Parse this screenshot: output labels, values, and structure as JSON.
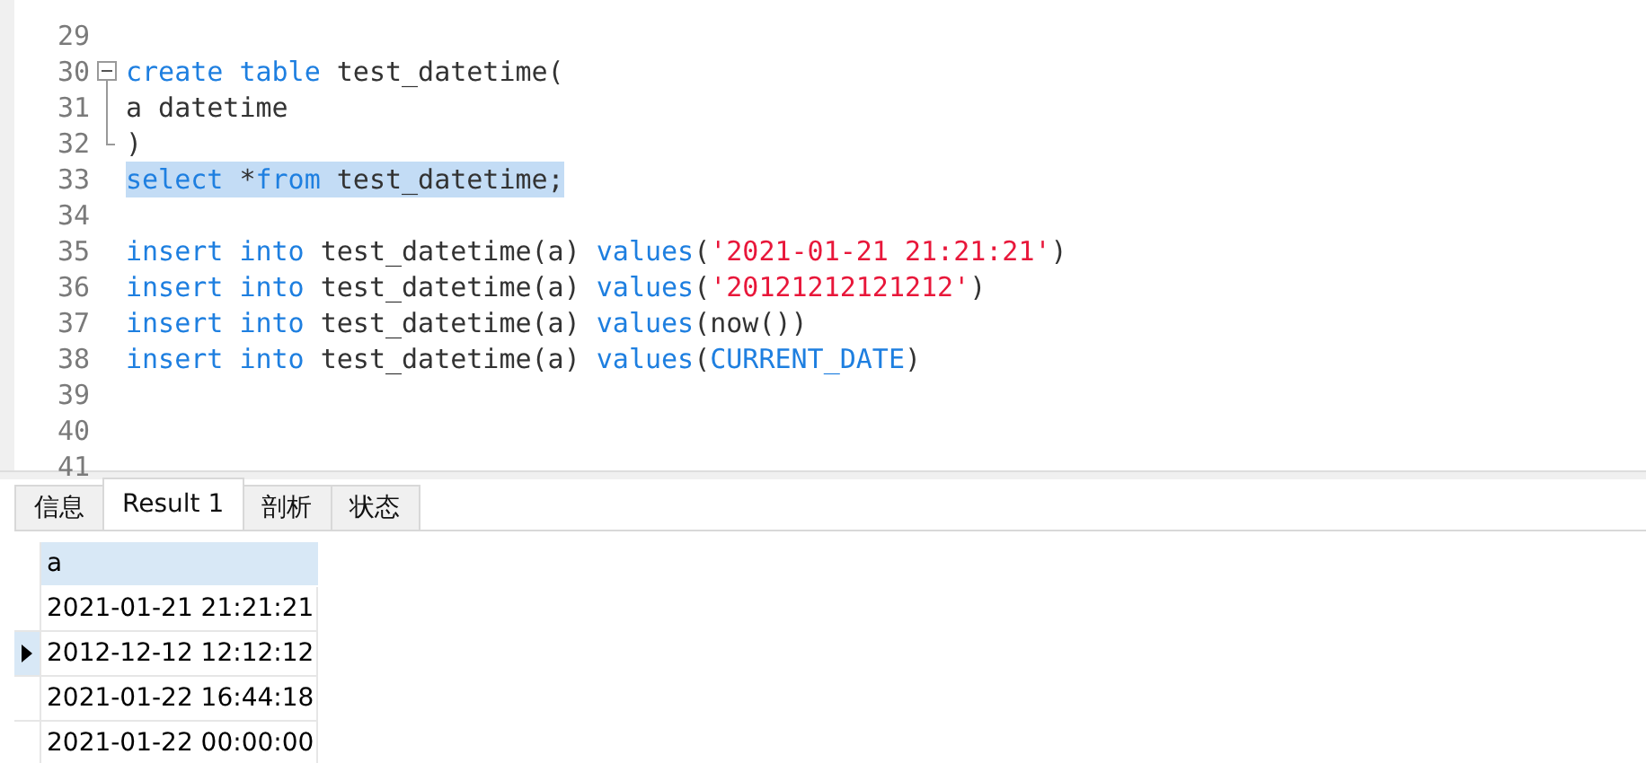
{
  "editor": {
    "lines": [
      {
        "number": "29",
        "kind": "plain",
        "selected": false
      },
      {
        "number": "30",
        "kind": "fold_start",
        "selected": false,
        "tokens": [
          {
            "kind": "keyword",
            "text": "create"
          },
          {
            "kind": "keyword",
            "text": " table"
          },
          {
            "kind": "plain",
            "text": " test_datetime("
          }
        ]
      },
      {
        "number": "31",
        "kind": "fold_line",
        "selected": false,
        "tokens": [
          {
            "kind": "plain",
            "text": "a datetime"
          }
        ]
      },
      {
        "number": "32",
        "kind": "fold_end",
        "selected": false,
        "tokens": [
          {
            "kind": "plain",
            "text": ")"
          }
        ]
      },
      {
        "number": "33",
        "kind": "plain",
        "selected": true,
        "tokens": [
          {
            "kind": "keyword",
            "text": "select"
          },
          {
            "kind": "plain",
            "text": " *"
          },
          {
            "kind": "keyword",
            "text": "from"
          },
          {
            "kind": "plain",
            "text": " test_datetime;"
          }
        ]
      },
      {
        "number": "34",
        "kind": "plain",
        "selected": false
      },
      {
        "number": "35",
        "kind": "plain",
        "selected": false,
        "tokens": [
          {
            "kind": "keyword",
            "text": "insert"
          },
          {
            "kind": "keyword",
            "text": " into"
          },
          {
            "kind": "plain",
            "text": " test_datetime(a) "
          },
          {
            "kind": "keyword",
            "text": "values"
          },
          {
            "kind": "plain",
            "text": "("
          },
          {
            "kind": "string",
            "text": "'2021-01-21 21:21:21'"
          },
          {
            "kind": "plain",
            "text": ")"
          }
        ]
      },
      {
        "number": "36",
        "kind": "plain",
        "selected": false,
        "tokens": [
          {
            "kind": "keyword",
            "text": "insert"
          },
          {
            "kind": "keyword",
            "text": " into"
          },
          {
            "kind": "plain",
            "text": " test_datetime(a) "
          },
          {
            "kind": "keyword",
            "text": "values"
          },
          {
            "kind": "plain",
            "text": "("
          },
          {
            "kind": "string",
            "text": "'20121212121212'"
          },
          {
            "kind": "plain",
            "text": ")"
          }
        ]
      },
      {
        "number": "37",
        "kind": "plain",
        "selected": false,
        "tokens": [
          {
            "kind": "keyword",
            "text": "insert"
          },
          {
            "kind": "keyword",
            "text": " into"
          },
          {
            "kind": "plain",
            "text": " test_datetime(a) "
          },
          {
            "kind": "keyword",
            "text": "values"
          },
          {
            "kind": "plain",
            "text": "(now())"
          }
        ]
      },
      {
        "number": "38",
        "kind": "plain",
        "selected": false,
        "tokens": [
          {
            "kind": "keyword",
            "text": "insert"
          },
          {
            "kind": "keyword",
            "text": " into"
          },
          {
            "kind": "plain",
            "text": " test_datetime(a) "
          },
          {
            "kind": "keyword",
            "text": "values"
          },
          {
            "kind": "plain",
            "text": "("
          },
          {
            "kind": "keyword",
            "text": "CURRENT_DATE"
          },
          {
            "kind": "plain",
            "text": ")"
          }
        ]
      },
      {
        "number": "39",
        "kind": "plain",
        "selected": false
      },
      {
        "number": "40",
        "kind": "plain",
        "selected": false
      },
      {
        "number": "41",
        "kind": "plain",
        "selected": false
      }
    ]
  },
  "tabs": [
    {
      "label": "信息",
      "selected": false
    },
    {
      "label": "Result 1",
      "selected": true
    },
    {
      "label": "剖析",
      "selected": false
    },
    {
      "label": "状态",
      "selected": false
    }
  ],
  "grid": {
    "columns": [
      "a"
    ],
    "rows": [
      {
        "cells": [
          "2021-01-21 21:21:21"
        ],
        "selected": false
      },
      {
        "cells": [
          "2012-12-12 12:12:12"
        ],
        "selected": true
      },
      {
        "cells": [
          "2021-01-22 16:44:18"
        ],
        "selected": false
      },
      {
        "cells": [
          "2021-01-22 00:00:00"
        ],
        "selected": false
      }
    ]
  }
}
